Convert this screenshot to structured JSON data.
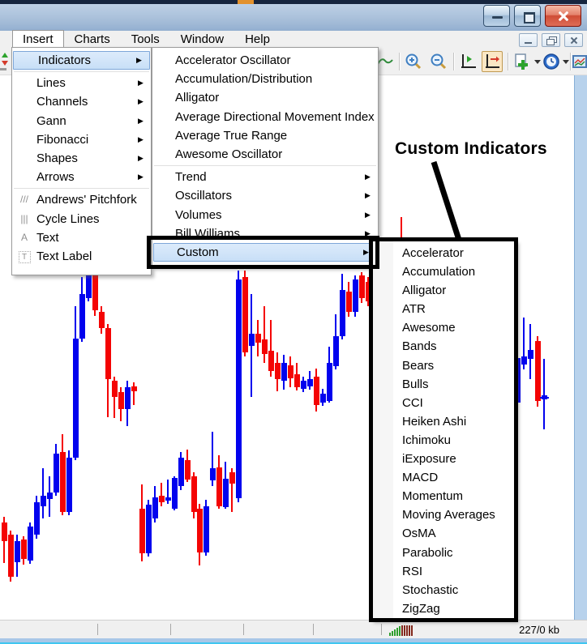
{
  "menubar": {
    "items": [
      {
        "label": "Insert",
        "open": true
      },
      {
        "label": "Charts"
      },
      {
        "label": "Tools"
      },
      {
        "label": "Window"
      },
      {
        "label": "Help"
      }
    ]
  },
  "insert_menu": {
    "items": [
      {
        "label": "Indicators",
        "arrow": true,
        "highlighted": true,
        "sep_after": true
      },
      {
        "label": "Lines",
        "arrow": true
      },
      {
        "label": "Channels",
        "arrow": true
      },
      {
        "label": "Gann",
        "arrow": true
      },
      {
        "label": "Fibonacci",
        "arrow": true
      },
      {
        "label": "Shapes",
        "arrow": true
      },
      {
        "label": "Arrows",
        "arrow": true,
        "sep_after": true
      },
      {
        "label": "Andrews' Pitchfork",
        "icon": "pitchfork-icon"
      },
      {
        "label": "Cycle Lines",
        "icon": "cycle-lines-icon"
      },
      {
        "label": "Text",
        "icon": "text-icon"
      },
      {
        "label": "Text Label",
        "icon": "text-label-icon"
      }
    ]
  },
  "indicators_menu": {
    "items": [
      {
        "label": "Accelerator Oscillator"
      },
      {
        "label": "Accumulation/Distribution"
      },
      {
        "label": "Alligator"
      },
      {
        "label": "Average Directional Movement Index"
      },
      {
        "label": "Average True Range"
      },
      {
        "label": "Awesome Oscillator",
        "sep_after": true
      },
      {
        "label": "Trend",
        "arrow": true
      },
      {
        "label": "Oscillators",
        "arrow": true
      },
      {
        "label": "Volumes",
        "arrow": true
      },
      {
        "label": "Bill Williams",
        "arrow": true
      },
      {
        "label": "Custom",
        "arrow": true,
        "highlighted": true
      }
    ]
  },
  "custom_menu": {
    "items": [
      "Accelerator",
      "Accumulation",
      "Alligator",
      "ATR",
      "Awesome",
      "Bands",
      "Bears",
      "Bulls",
      "CCI",
      "Heiken Ashi",
      "Ichimoku",
      "iExposure",
      "MACD",
      "Momentum",
      "Moving Averages",
      "OsMA",
      "Parabolic",
      "RSI",
      "Stochastic",
      "ZigZag"
    ]
  },
  "annotation": {
    "label": "Custom Indicators"
  },
  "statusbar": {
    "traffic": "227/0 kb"
  },
  "icon_names": [
    "pitchfork-icon",
    "cycle-lines-icon",
    "text-icon",
    "text-label-icon",
    "zoom-in-icon",
    "zoom-out-icon",
    "chart-shift-icon",
    "auto-scroll-icon",
    "new-chart-icon",
    "periods-clock-icon",
    "templates-icon",
    "new-order-icon"
  ],
  "chart": {
    "up_color": "#0202ee",
    "down_color": "#f40404",
    "candles": [
      [
        2,
        "r",
        645,
        668,
        638,
        695
      ],
      [
        10,
        "r",
        660,
        712,
        655,
        718
      ],
      [
        18,
        "b",
        668,
        694,
        660,
        712
      ],
      [
        26,
        "r",
        666,
        690,
        662,
        697
      ],
      [
        34,
        "b",
        650,
        692,
        645,
        696
      ],
      [
        42,
        "b",
        620,
        660,
        612,
        665
      ],
      [
        50,
        "b",
        612,
        625,
        578,
        640
      ],
      [
        58,
        "b",
        608,
        616,
        588,
        638
      ],
      [
        66,
        "b",
        560,
        608,
        548,
        612
      ],
      [
        74,
        "r",
        558,
        632,
        536,
        636
      ],
      [
        82,
        "b",
        565,
        632,
        556,
        636
      ],
      [
        90,
        "b",
        418,
        565,
        378,
        568
      ],
      [
        98,
        "b",
        363,
        418,
        342,
        422
      ],
      [
        106,
        "b",
        332,
        368,
        332,
        372
      ],
      [
        114,
        "r",
        336,
        383,
        336,
        390
      ],
      [
        122,
        "r",
        385,
        405,
        378,
        412
      ],
      [
        130,
        "r",
        405,
        468,
        400,
        515
      ],
      [
        138,
        "r",
        470,
        490,
        465,
        516
      ],
      [
        146,
        "r",
        484,
        505,
        478,
        520
      ],
      [
        154,
        "b",
        478,
        505,
        470,
        526
      ],
      [
        162,
        "r",
        477,
        483,
        472,
        500
      ],
      [
        172,
        "r",
        628,
        683,
        598,
        693
      ],
      [
        180,
        "b",
        623,
        683,
        617,
        687
      ],
      [
        188,
        "b",
        614,
        640,
        600,
        645
      ],
      [
        196,
        "r",
        612,
        620,
        596,
        625
      ],
      [
        204,
        "b",
        614,
        618,
        592,
        622
      ],
      [
        212,
        "b",
        590,
        628,
        588,
        630
      ],
      [
        220,
        "b",
        565,
        600,
        558,
        605
      ],
      [
        228,
        "r",
        568,
        592,
        555,
        595
      ],
      [
        236,
        "r",
        588,
        632,
        583,
        640
      ],
      [
        243,
        "r",
        628,
        682,
        622,
        698
      ],
      [
        251,
        "b",
        625,
        682,
        617,
        686
      ],
      [
        259,
        "b",
        578,
        593,
        533,
        600
      ],
      [
        267,
        "r",
        577,
        625,
        562,
        628
      ],
      [
        275,
        "b",
        591,
        626,
        570,
        628
      ],
      [
        283,
        "r",
        583,
        597,
        578,
        632
      ],
      [
        291,
        "b",
        345,
        615,
        334,
        620
      ],
      [
        299,
        "r",
        342,
        435,
        334,
        440
      ],
      [
        307,
        "b",
        412,
        427,
        363,
        490
      ],
      [
        315,
        "r",
        412,
        423,
        395,
        440
      ],
      [
        323,
        "r",
        419,
        437,
        378,
        448
      ],
      [
        331,
        "r",
        433,
        458,
        395,
        465
      ],
      [
        339,
        "r",
        448,
        468,
        435,
        483
      ],
      [
        347,
        "b",
        448,
        470,
        438,
        481
      ],
      [
        355,
        "r",
        451,
        467,
        440,
        478
      ],
      [
        363,
        "r",
        462,
        478,
        448,
        482
      ],
      [
        371,
        "b",
        470,
        480,
        465,
        484
      ],
      [
        379,
        "b",
        468,
        477,
        458,
        481
      ],
      [
        387,
        "r",
        465,
        500,
        455,
        508
      ],
      [
        395,
        "b",
        486,
        497,
        480,
        501
      ],
      [
        403,
        "b",
        448,
        495,
        428,
        497
      ],
      [
        411,
        "b",
        415,
        452,
        388,
        456
      ],
      [
        419,
        "b",
        358,
        415,
        338,
        419
      ],
      [
        427,
        "r",
        360,
        385,
        348,
        391
      ],
      [
        435,
        "b",
        345,
        385,
        340,
        391
      ],
      [
        443,
        "r",
        340,
        368,
        336,
        374
      ],
      [
        451,
        "r",
        348,
        372,
        342,
        378
      ],
      [
        492,
        "r",
        294,
        296,
        268,
        296
      ],
      [
        635,
        "b",
        442,
        497,
        435,
        552
      ],
      [
        643,
        "b",
        440,
        450,
        392,
        456
      ],
      [
        651,
        "b",
        432,
        443,
        400,
        468
      ],
      [
        660,
        "r",
        421,
        495,
        415,
        502
      ],
      [
        668,
        "b",
        488,
        493,
        443,
        530,
        490
      ]
    ]
  }
}
